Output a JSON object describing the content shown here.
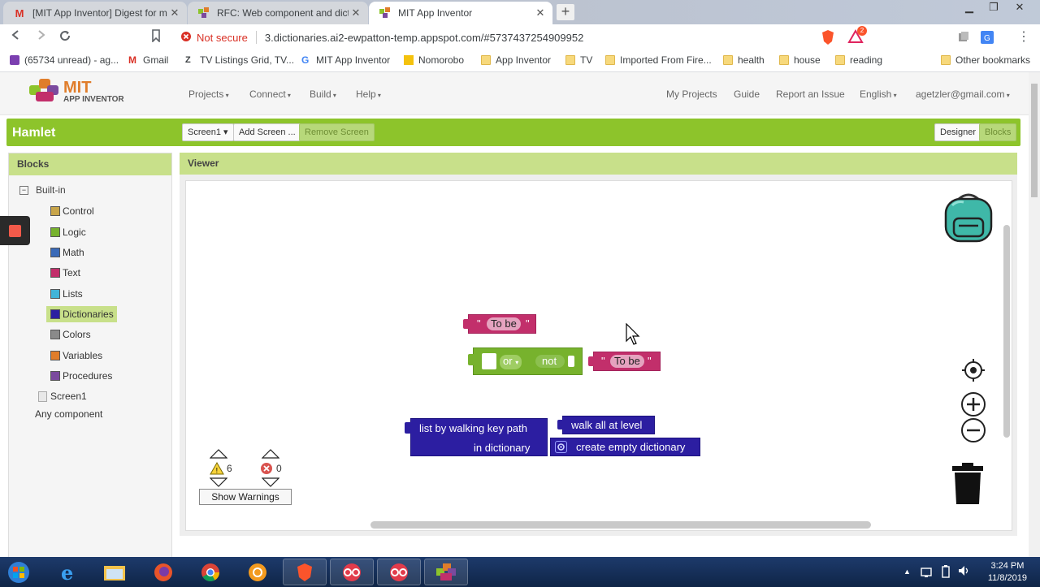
{
  "browser": {
    "tabs": [
      {
        "title": "[MIT App Inventor] Digest for mita",
        "active": false
      },
      {
        "title": "RFC: Web component and dictiona",
        "active": false
      },
      {
        "title": "MIT App Inventor",
        "active": true
      }
    ],
    "security_label": "Not secure",
    "url": "3.dictionaries.ai2-ewpatton-temp.appspot.com/#5737437254909952",
    "brave_badge": "2",
    "bookmarks": [
      {
        "label": "(65734 unread) - ag...",
        "icon": "mail-icon"
      },
      {
        "label": "Gmail",
        "icon": "gmail-icon"
      },
      {
        "label": "TV Listings Grid, TV...",
        "icon": "z-icon"
      },
      {
        "label": "MIT App Inventor",
        "icon": "google-icon"
      },
      {
        "label": "Nomorobo",
        "icon": "nomorobo-icon"
      },
      {
        "label": "App Inventor",
        "icon": "folder-icon"
      },
      {
        "label": "TV",
        "icon": "folder-icon"
      },
      {
        "label": "Imported From Fire...",
        "icon": "folder-icon"
      },
      {
        "label": "health",
        "icon": "folder-icon"
      },
      {
        "label": "house",
        "icon": "folder-icon"
      },
      {
        "label": "reading",
        "icon": "folder-icon"
      },
      {
        "label": "Other bookmarks",
        "icon": "folder-icon"
      }
    ]
  },
  "app": {
    "logo_top": "MIT",
    "logo_bottom": "APP INVENTOR",
    "menus": [
      "Projects",
      "Connect",
      "Build",
      "Help"
    ],
    "links": [
      "My Projects",
      "Guide",
      "Report an Issue"
    ],
    "language": "English",
    "account": "agetzler@gmail.com",
    "project_name": "Hamlet",
    "screen_select": "Screen1",
    "add_screen": "Add Screen ...",
    "remove_screen": "Remove Screen",
    "designer_btn": "Designer",
    "blocks_btn": "Blocks"
  },
  "blocks_panel": {
    "header": "Blocks",
    "builtin_label": "Built-in",
    "categories": [
      {
        "label": "Control",
        "color": "#c8a54a"
      },
      {
        "label": "Logic",
        "color": "#77b22d"
      },
      {
        "label": "Math",
        "color": "#3a6ab8"
      },
      {
        "label": "Text",
        "color": "#c22f6b"
      },
      {
        "label": "Lists",
        "color": "#41b4d8"
      },
      {
        "label": "Dictionaries",
        "color": "#2c1ea1"
      },
      {
        "label": "Colors",
        "color": "#8a8a8a"
      },
      {
        "label": "Variables",
        "color": "#e07d2a"
      },
      {
        "label": "Procedures",
        "color": "#7b4a9e"
      }
    ],
    "screen_label": "Screen1",
    "any_component": "Any component"
  },
  "viewer": {
    "header": "Viewer",
    "blocks": {
      "text1": "To be",
      "or_label": "or",
      "not_label": "not",
      "text2": "To be",
      "walk_key_path": "list by walking key path",
      "in_dictionary": "in dictionary",
      "walk_all": "walk all at level",
      "create_empty": "create empty dictionary"
    },
    "warning_count": "6",
    "error_count": "0",
    "show_warnings": "Show Warnings"
  },
  "taskbar": {
    "time": "3:24 PM",
    "date": "11/8/2019"
  }
}
